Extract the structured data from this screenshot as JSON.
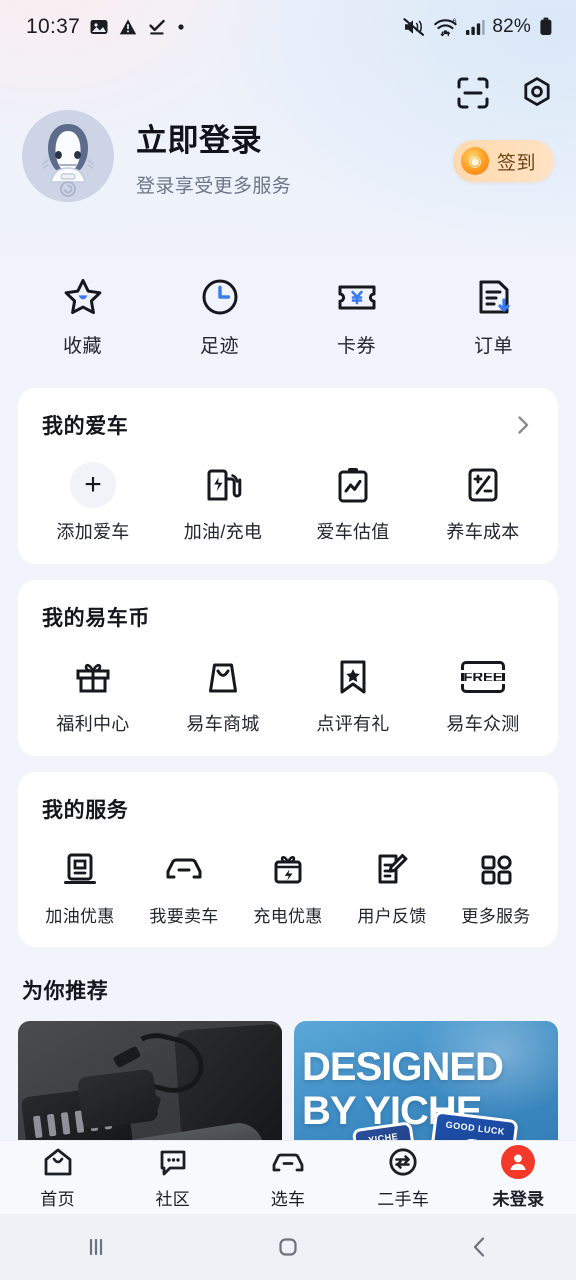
{
  "statusbar": {
    "time": "10:37",
    "battery_percent": "82%",
    "left_icons": [
      "image-icon",
      "warning-icon",
      "check-download-icon",
      "dot-icon"
    ],
    "right_icons": [
      "mute-icon",
      "wifi-6-icon",
      "signal-bars-icon",
      "battery-icon"
    ]
  },
  "header": {
    "scan_icon": "scan-icon",
    "settings_icon": "settings-icon",
    "signin_label": "签到",
    "signin_coin_glyph": "◉",
    "avatar_name": "shark-mascot-avatar",
    "title": "立即登录",
    "subtitle": "登录享受更多服务"
  },
  "quick_actions": [
    {
      "label": "收藏",
      "icon": "star-favorite-icon"
    },
    {
      "label": "足迹",
      "icon": "clock-history-icon"
    },
    {
      "label": "卡券",
      "icon": "coupon-ticket-icon"
    },
    {
      "label": "订单",
      "icon": "order-document-icon"
    }
  ],
  "my_car": {
    "title": "我的爱车",
    "chevron": "chevron-right-icon",
    "items": [
      {
        "label": "添加爱车",
        "icon": "plus-icon"
      },
      {
        "label": "加油/充电",
        "icon": "fuel-charge-icon"
      },
      {
        "label": "爱车估值",
        "icon": "valuation-clipboard-icon"
      },
      {
        "label": "养车成本",
        "icon": "cost-calculator-icon"
      }
    ]
  },
  "my_coins": {
    "title": "我的易车币",
    "items": [
      {
        "label": "福利中心",
        "icon": "gift-icon"
      },
      {
        "label": "易车商城",
        "icon": "shopping-bag-icon"
      },
      {
        "label": "点评有礼",
        "icon": "bookmark-star-icon"
      },
      {
        "label": "易车众测",
        "icon": "free-badge-icon",
        "text": "FREE"
      }
    ]
  },
  "my_services": {
    "title": "我的服务",
    "items": [
      {
        "label": "加油优惠",
        "icon": "fuel-pump-icon"
      },
      {
        "label": "我要卖车",
        "icon": "sell-car-icon"
      },
      {
        "label": "充电优惠",
        "icon": "charge-gift-icon"
      },
      {
        "label": "用户反馈",
        "icon": "feedback-edit-icon"
      },
      {
        "label": "更多服务",
        "icon": "grid-more-icon"
      }
    ]
  },
  "recommend": {
    "title": "为你推荐",
    "cards": [
      {
        "name": "electric-screwdriver-product-card",
        "alt": "电动螺丝刀套装"
      },
      {
        "name": "designed-by-yiche-banner-card",
        "line1": "DESIGNED",
        "line2": "BY YICHE",
        "sticker_a": "YICHE",
        "sticker_b": "GOOD LUCK"
      }
    ]
  },
  "tabbar": [
    {
      "label": "首页",
      "icon": "home-icon",
      "active": false
    },
    {
      "label": "社区",
      "icon": "community-chat-icon",
      "active": false
    },
    {
      "label": "选车",
      "icon": "select-car-icon",
      "active": false
    },
    {
      "label": "二手车",
      "icon": "used-car-exchange-icon",
      "active": false
    },
    {
      "label": "未登录",
      "icon": "user-avatar-icon",
      "active": true
    }
  ],
  "sysnav": [
    {
      "icon": "recents-icon"
    },
    {
      "icon": "home-square-icon"
    },
    {
      "icon": "back-chevron-icon"
    }
  ],
  "colors": {
    "accent_blue": "#3b7bf0",
    "accent_red": "#f4392b",
    "signin_gold": "#ff9b1e",
    "text_primary": "#14161c",
    "text_secondary": "#6e7686",
    "card_bg": "#ffffff",
    "page_bg": "#f2f4fb"
  }
}
